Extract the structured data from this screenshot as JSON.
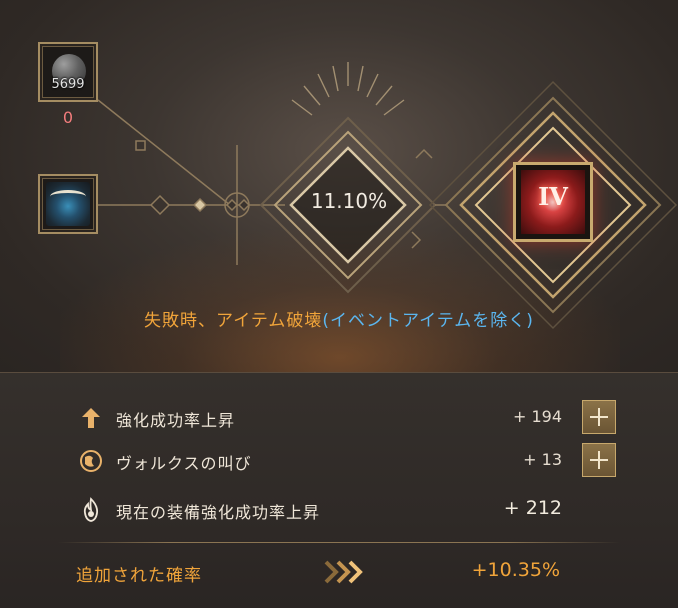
{
  "materials": {
    "stone": {
      "icon": "black-stone-icon",
      "count": "5699",
      "required": "0",
      "required_color": "#f27c7c"
    },
    "equipment": {
      "icon": "helmet-icon"
    }
  },
  "enhance": {
    "success_rate": "11.10%",
    "target_grade": "IV",
    "target_icon": "red-gem-icon"
  },
  "warning": {
    "main": "失敗時、アイテム破壊",
    "paren": "(イベントアイテムを除く)",
    "main_color": "#f0a43a",
    "paren_color": "#5bb6ef"
  },
  "bonuses": [
    {
      "label": "強化成功率上昇",
      "value": "+ 194",
      "icon": "arrow-up-icon"
    },
    {
      "label": "ヴォルクスの叫び",
      "value": "+ 13",
      "icon": "globe-icon"
    },
    {
      "label": "現在の装備強化成功率上昇",
      "value": "+ 212",
      "icon": "flame-icon"
    }
  ],
  "added": {
    "label": "追加された確率",
    "value": "+10.35%"
  },
  "colors": {
    "accent": "#f0a43a",
    "frame": "#c9aa6f"
  }
}
